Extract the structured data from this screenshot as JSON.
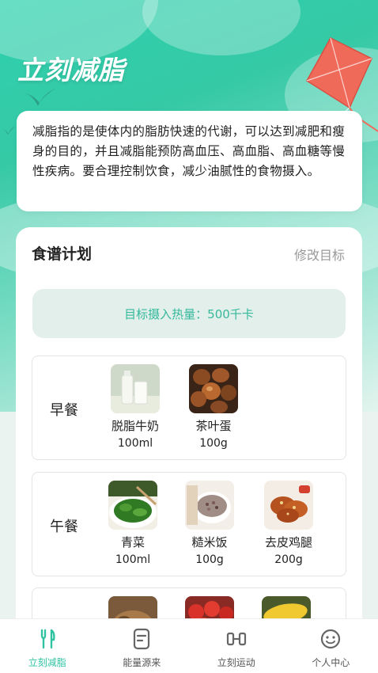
{
  "hero": {
    "title": "立刻减脂"
  },
  "intro": {
    "text": "减脂指的是使体内的脂肪快速的代谢，可以达到减肥和瘦身的目的，并且减脂能预防高血压、高血脂、高血糖等慢性疾病。要合理控制饮食，减少油腻性的食物摄入。"
  },
  "plan": {
    "title": "食谱计划",
    "edit_label": "修改目标",
    "target_text": "目标摄入热量：500千卡",
    "meals": [
      {
        "label": "早餐",
        "foods": [
          {
            "name": "脱脂牛奶",
            "amount": "100ml",
            "icon": "milk-image"
          },
          {
            "name": "茶叶蛋",
            "amount": "100g",
            "icon": "tea-egg-image"
          }
        ]
      },
      {
        "label": "午餐",
        "foods": [
          {
            "name": "青菜",
            "amount": "100ml",
            "icon": "greens-image"
          },
          {
            "name": "糙米饭",
            "amount": "100g",
            "icon": "brown-rice-image"
          },
          {
            "name": "去皮鸡腿",
            "amount": "200g",
            "icon": "chicken-leg-image"
          }
        ]
      }
    ]
  },
  "tabs": [
    {
      "label": "立刻减脂",
      "icon": "fork-knife-icon",
      "active": true
    },
    {
      "label": "能量源来",
      "icon": "document-icon",
      "active": false
    },
    {
      "label": "立刻运动",
      "icon": "dumbbell-icon",
      "active": false
    },
    {
      "label": "个人中心",
      "icon": "face-icon",
      "active": false
    }
  ],
  "colors": {
    "accent": "#2fc3a2",
    "target_text": "#35b99b",
    "target_bg": "#e3efeb"
  }
}
